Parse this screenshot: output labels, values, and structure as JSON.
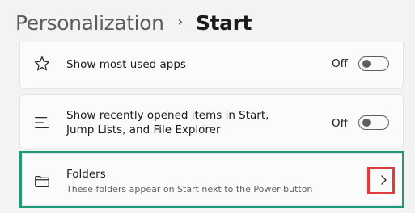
{
  "breadcrumb": {
    "parent": "Personalization",
    "separator": "›",
    "current": "Start"
  },
  "settings": [
    {
      "title": "Show most used apps",
      "icon": "star-icon",
      "toggle_label": "Off",
      "toggle_on": false
    },
    {
      "title": "Show recently opened items in Start,\nJump Lists, and File Explorer",
      "icon": "list-icon",
      "toggle_label": "Off",
      "toggle_on": false
    },
    {
      "title": "Folders",
      "subtitle": "These folders appear on Start next to the Power button",
      "icon": "folder-icon",
      "action": "chevron-right-icon"
    }
  ],
  "colors": {
    "page_background": "#f3f3f3",
    "card_background": "#fbfbfb",
    "highlight_green": "#1a9c7c",
    "highlight_red": "#e03c3c"
  }
}
